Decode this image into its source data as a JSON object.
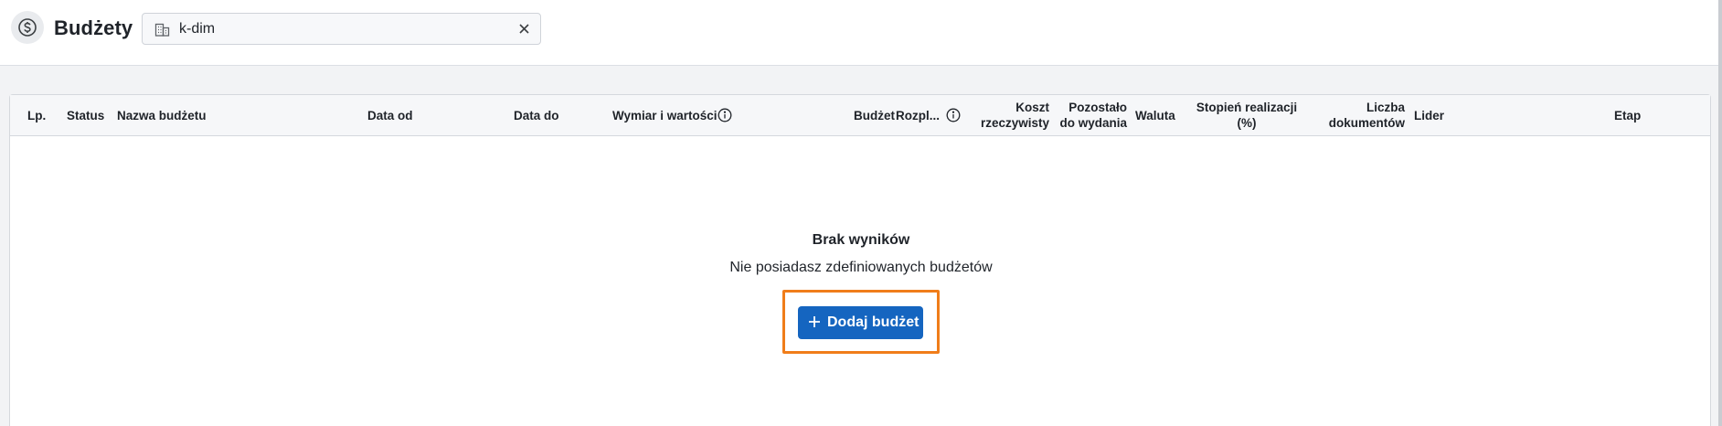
{
  "header": {
    "title": "Budżety",
    "context_value": "k-dim",
    "app_icon": "dollar-circle-icon",
    "context_icon": "building-icon",
    "clear_icon": "close-icon"
  },
  "table": {
    "columns": [
      {
        "key": "lp",
        "label": "Lp."
      },
      {
        "key": "status",
        "label": "Status"
      },
      {
        "key": "name",
        "label": "Nazwa budżetu"
      },
      {
        "key": "date_from",
        "label": "Data od"
      },
      {
        "key": "date_to",
        "label": "Data do"
      },
      {
        "key": "dimension",
        "label": "Wymiar i wartości"
      },
      {
        "key": "budget",
        "label": "Budżet"
      },
      {
        "key": "distribution",
        "label": "Rozpl..."
      },
      {
        "key": "actual_cost",
        "label": [
          "Koszt",
          "rzeczywisty"
        ]
      },
      {
        "key": "remaining",
        "label": [
          "Pozostało",
          "do wydania"
        ]
      },
      {
        "key": "currency",
        "label": "Waluta"
      },
      {
        "key": "progress",
        "label": [
          "Stopień realizacji",
          "(%)"
        ]
      },
      {
        "key": "doc_count",
        "label": [
          "Liczba",
          "dokumentów"
        ]
      },
      {
        "key": "leader",
        "label": "Lider"
      },
      {
        "key": "stage",
        "label": "Etap"
      }
    ]
  },
  "empty_state": {
    "title": "Brak wyników",
    "subtitle": "Nie posiadasz zdefiniowanych budżetów",
    "button_label": "Dodaj budżet",
    "button_icon": "plus-icon"
  },
  "colors": {
    "primary": "#1565c0",
    "highlight": "#f07d1a",
    "header_bg": "#f6f7f9",
    "page_bg": "#f2f3f5"
  }
}
